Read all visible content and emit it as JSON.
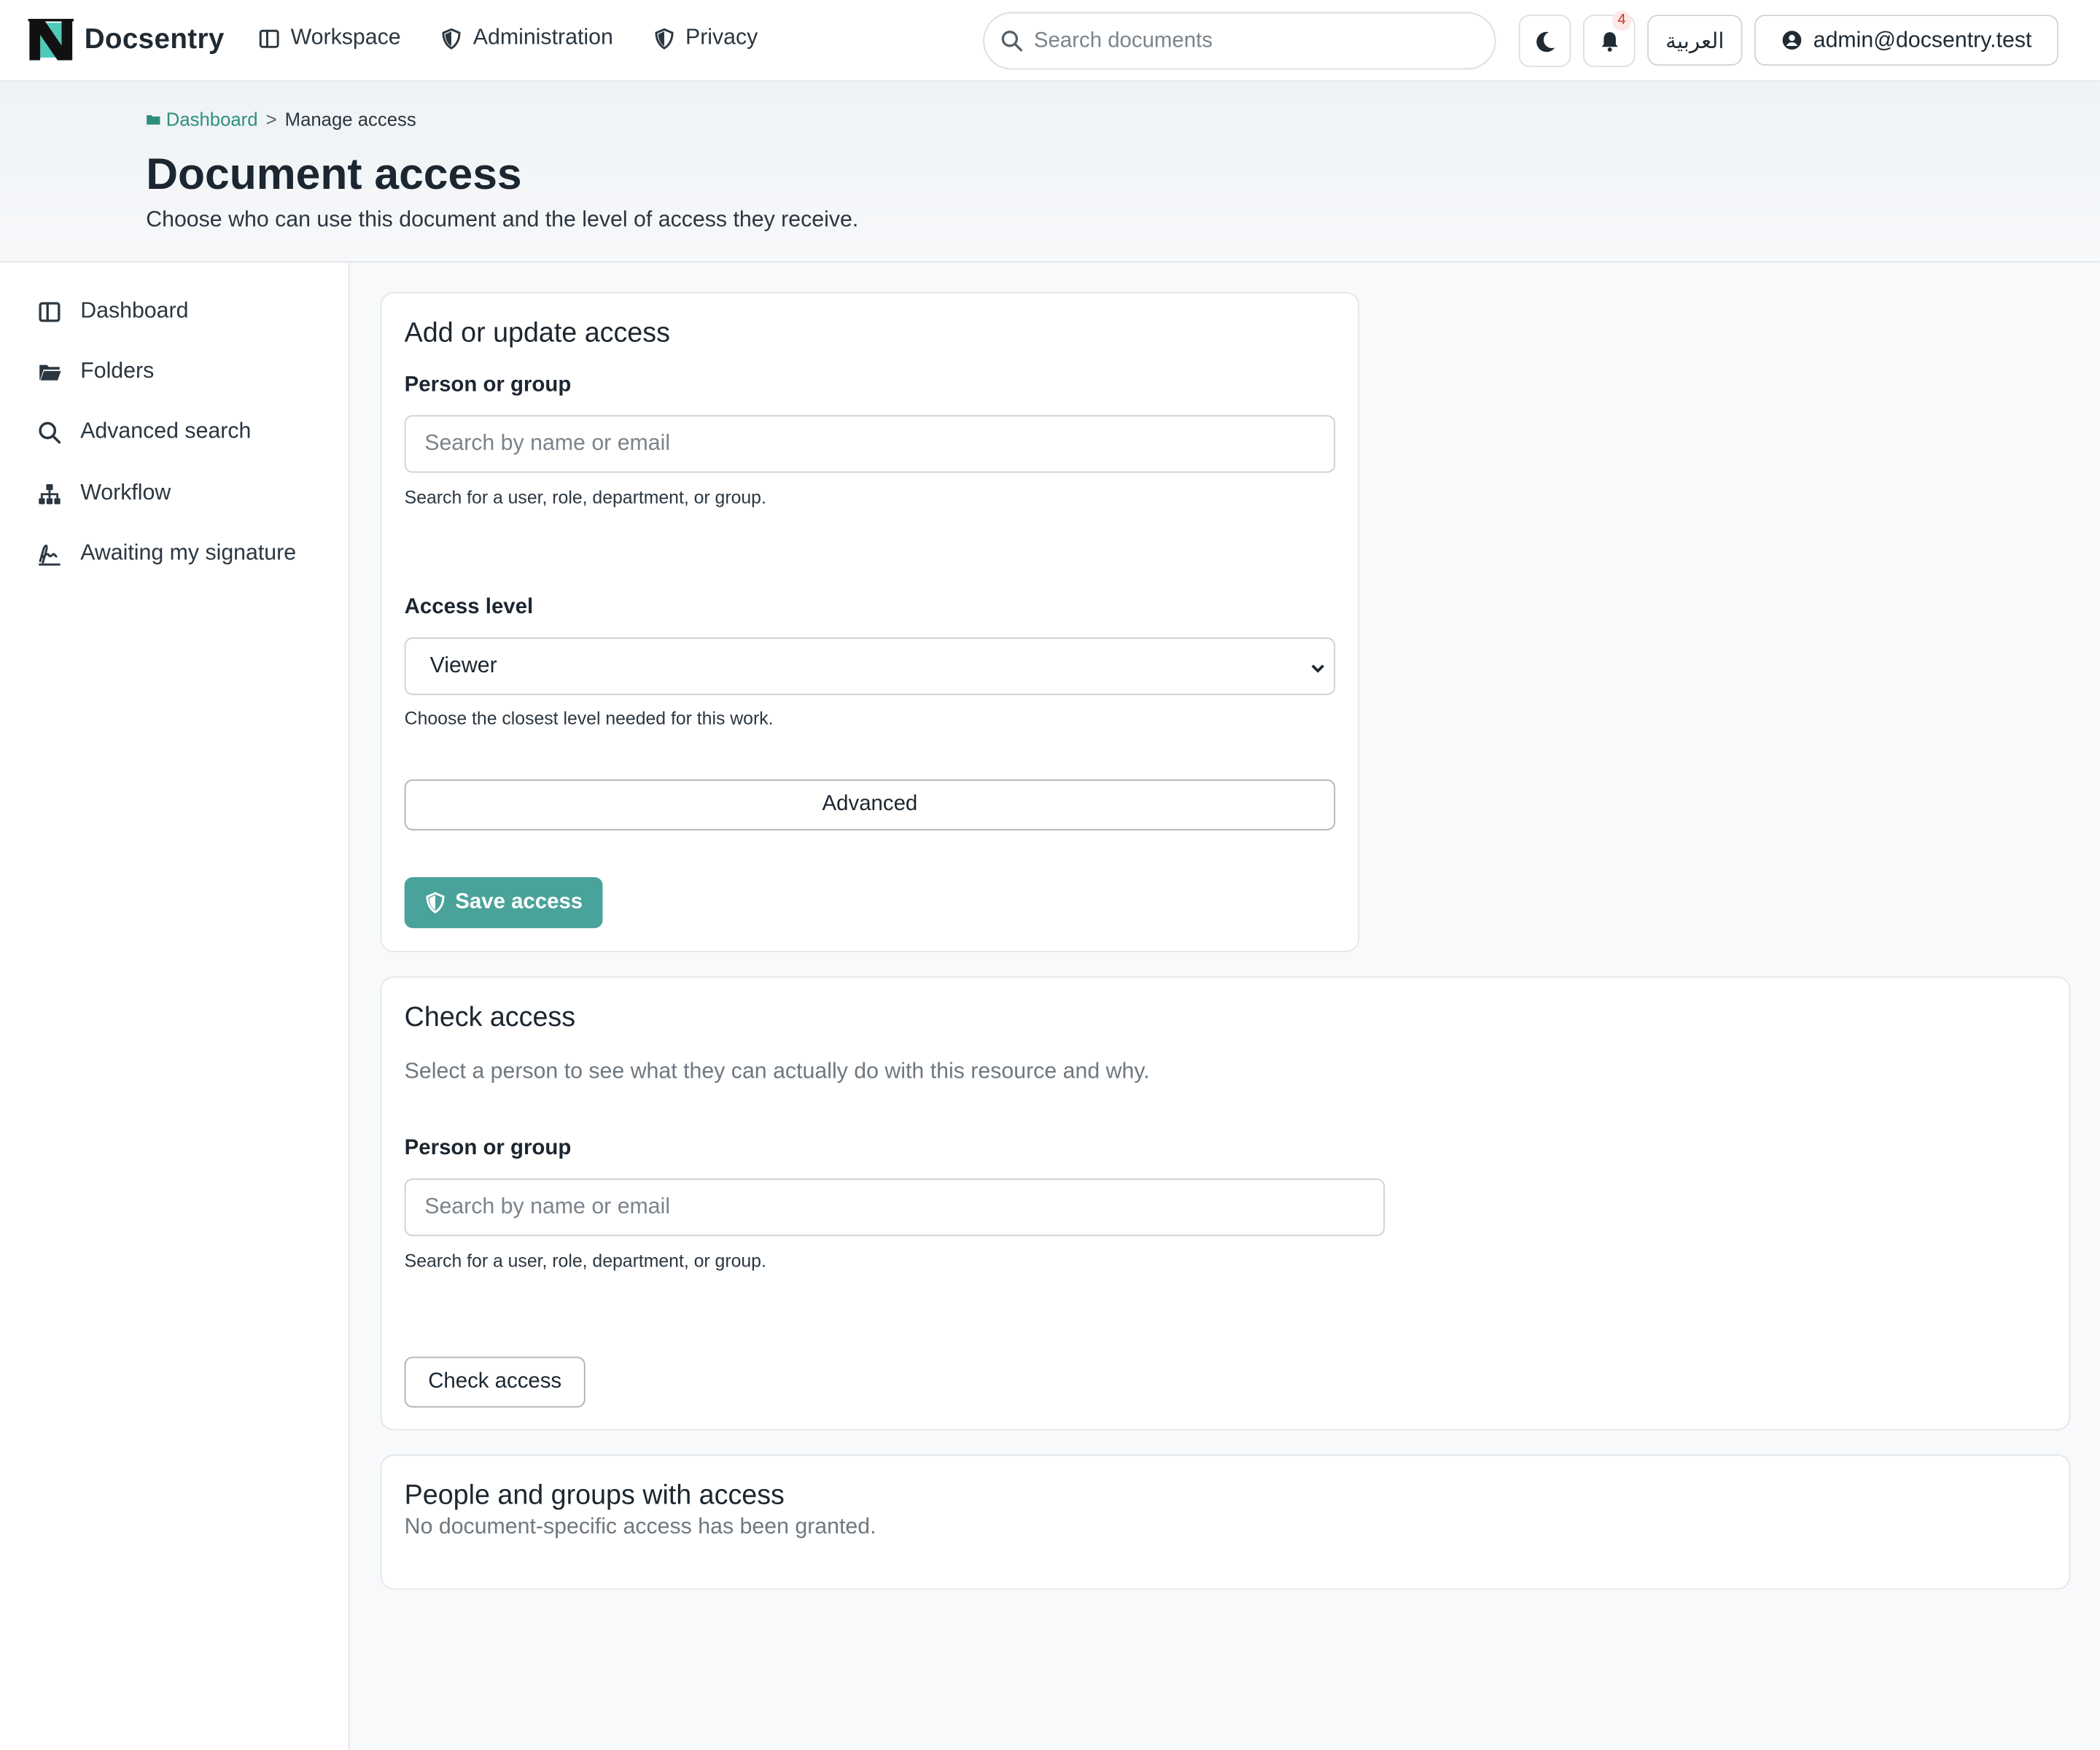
{
  "app": {
    "name": "Docsentry"
  },
  "topnav": {
    "items": [
      {
        "label": "Workspace",
        "icon": "columns-icon"
      },
      {
        "label": "Administration",
        "icon": "shield-icon"
      },
      {
        "label": "Privacy",
        "icon": "shield-icon"
      }
    ],
    "search_placeholder": "Search documents",
    "notifications_count": "4",
    "language_label": "العربية",
    "user_label": "admin@docsentry.test"
  },
  "breadcrumb": {
    "home": "Dashboard",
    "separator": ">",
    "current": "Manage access"
  },
  "header": {
    "title": "Document access",
    "subtitle": "Choose who can use this document and the level of access they receive."
  },
  "sidebar": {
    "items": [
      {
        "label": "Dashboard",
        "icon": "dashboard-icon"
      },
      {
        "label": "Folders",
        "icon": "folder-icon"
      },
      {
        "label": "Advanced search",
        "icon": "search-icon"
      },
      {
        "label": "Workflow",
        "icon": "workflow-icon"
      },
      {
        "label": "Awaiting my signature",
        "icon": "signature-icon"
      }
    ]
  },
  "add_access": {
    "title": "Add or update access",
    "person_label": "Person or group",
    "person_placeholder": "Search by name or email",
    "person_help": "Search for a user, role, department, or group.",
    "level_label": "Access level",
    "level_value": "Viewer",
    "level_help": "Choose the closest level needed for this work.",
    "advanced_label": "Advanced",
    "save_label": "Save access"
  },
  "check_access": {
    "title": "Check access",
    "description": "Select a person to see what they can actually do with this resource and why.",
    "person_label": "Person or group",
    "person_placeholder": "Search by name or email",
    "person_help": "Search for a user, role, department, or group.",
    "button_label": "Check access"
  },
  "people": {
    "title": "People and groups with access",
    "empty_message": "No document-specific access has been granted."
  },
  "colors": {
    "accent": "#4aa39a",
    "link": "#2f8f7e",
    "text": "#1c2630"
  }
}
